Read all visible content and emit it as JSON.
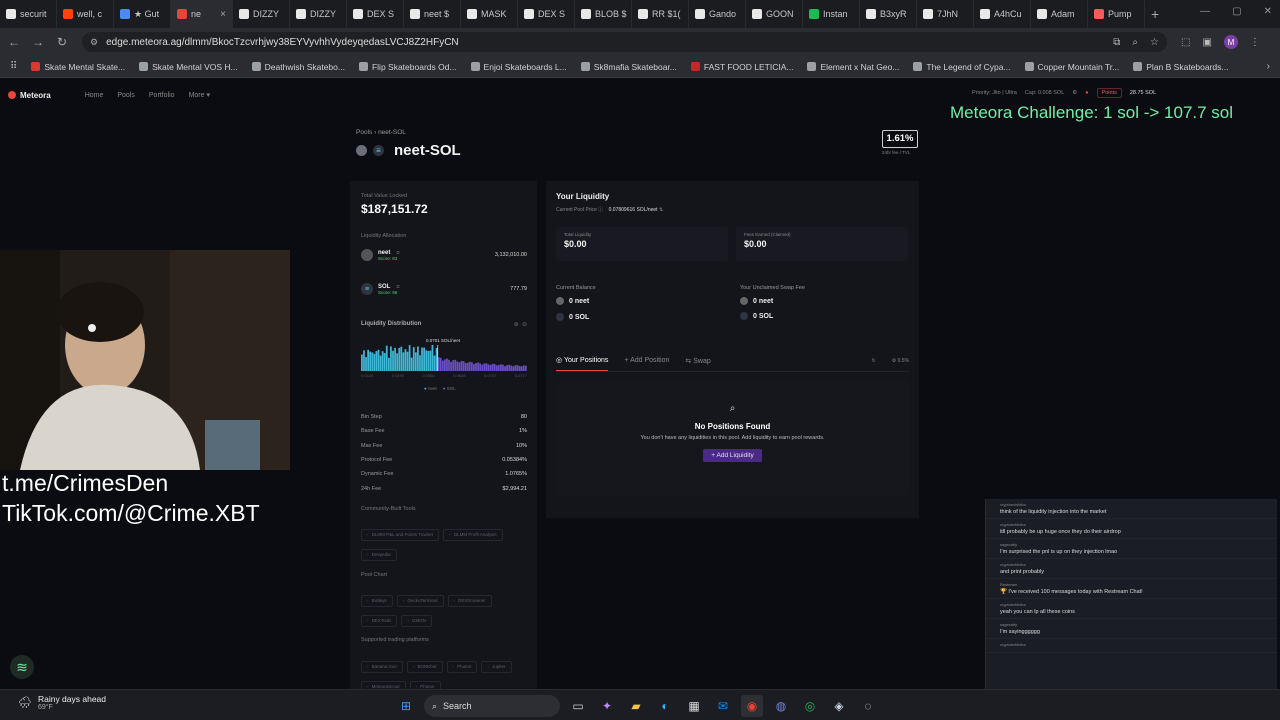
{
  "browser": {
    "tabs": [
      {
        "label": "securit",
        "icon": "doc-icon"
      },
      {
        "label": "well, c",
        "icon": "reddit-icon"
      },
      {
        "label": "★ Gut",
        "icon": "bookmark-icon"
      },
      {
        "label": "ne",
        "icon": "meteora-icon",
        "active": true
      },
      {
        "label": "DIZZY",
        "icon": "dex-icon"
      },
      {
        "label": "DIZZY",
        "icon": "dex-icon"
      },
      {
        "label": "DEX S",
        "icon": "dex-icon"
      },
      {
        "label": "neet $",
        "icon": "dex-icon"
      },
      {
        "label": "MASK",
        "icon": "dex-icon"
      },
      {
        "label": "DEX S",
        "icon": "dex-icon"
      },
      {
        "label": "BLOB $",
        "icon": "dex-icon"
      },
      {
        "label": "RR $1(",
        "icon": "dex-icon"
      },
      {
        "label": "Gando",
        "icon": "dex-icon"
      },
      {
        "label": "GOON",
        "icon": "dex-icon"
      },
      {
        "label": "Instan",
        "icon": "spotify-icon"
      },
      {
        "label": "B3xyR",
        "icon": "globe-icon"
      },
      {
        "label": "7JhN",
        "icon": "globe-icon"
      },
      {
        "label": "A4hCu",
        "icon": "globe-icon"
      },
      {
        "label": "Adam",
        "icon": "x-icon"
      },
      {
        "label": "Pump",
        "icon": "pump-icon"
      }
    ],
    "new_tab_glyph": "+",
    "url": "edge.meteora.ag/dlmm/BkocTzcvrhjwy38EYVyvhhVydeyqedasLVCJ8Z2HFyCN",
    "bookmarks": [
      "Skate Mental Skate...",
      "Skate Mental VOS H...",
      "Deathwish Skatebo...",
      "Flip Skateboards Od...",
      "Enjoi Skateboards L...",
      "Sk8mafia Skateboar...",
      "FAST FOOD LETICIA...",
      "Element x Nat Geo...",
      "The Legend of Cypa...",
      "Copper Mountain Tr...",
      "Plan B Skateboards..."
    ],
    "bookmark_colors": [
      "#d83b2b",
      "#9aa0a6",
      "#9aa0a6",
      "#9aa0a6",
      "#9aa0a6",
      "#9aa0a6",
      "#c62828",
      "#9aa0a6",
      "#9aa0a6",
      "#9aa0a6",
      "#9aa0a6"
    ],
    "profile_initial": "M"
  },
  "meteora": {
    "brand": "Meteora",
    "nav": [
      "Home",
      "Pools",
      "Portfolio",
      "More"
    ],
    "top_right": {
      "priority": "Priority: Jito | Ultra",
      "cap": "Cap: 0.008 SOL",
      "points": "Points",
      "balance": "28.75 SOL"
    }
  },
  "overlay": {
    "challenge": "Meteora Challenge: 1 sol -> 107.7 sol",
    "telegram": "t.me/CrimesDen",
    "tiktok": "TikTok.com/@Crime.XBT"
  },
  "pool": {
    "breadcrumb": [
      "Pools",
      "neet-SOL"
    ],
    "name": "neet-SOL",
    "apr": "1.61%",
    "apr_label": "24hr fee / TVL",
    "tvl_label": "Total Value Locked",
    "tvl": "$187,151.72",
    "alloc_label": "Liquidity Allocation",
    "tokens": [
      {
        "symbol": "neet",
        "score": "Score: 83",
        "amount": "3,132,010.00"
      },
      {
        "symbol": "SOL",
        "score": "Score: 96",
        "amount": "777.79"
      }
    ],
    "dist_label": "Liquidity Distribution",
    "dist_price": "0.0701 SOL/neet",
    "dist_axis": [
      "0.0420",
      "0.0490",
      "0.0560",
      "0.0638",
      "0.0707",
      "0.0777"
    ],
    "dist_legend": [
      "neet",
      "SOL"
    ],
    "params": [
      {
        "label": "Bin Step",
        "value": "80"
      },
      {
        "label": "Base Fee",
        "value": "1%"
      },
      {
        "label": "Max Fee",
        "value": "10%"
      },
      {
        "label": "Protocol Fee",
        "value": "0.05384%"
      },
      {
        "label": "Dynamic Fee",
        "value": "1.0765%"
      },
      {
        "label": "24h Fee",
        "value": "$2,994.21"
      }
    ],
    "community_label": "Community-Built Tools",
    "community_tools": [
      "DLMM P&L and Points Tracker",
      "DLMM Profit Analysis",
      "Dexpedia"
    ],
    "chart_label": "Pool Chart",
    "chart_links": [
      "Birdeye",
      "GeckoTerminal",
      "DEXScreener",
      "DEXTools",
      "GMGN"
    ],
    "platforms_label": "Supported trading platforms",
    "platforms": [
      "Banana Gun",
      "BONKbot",
      "Photon",
      "Jupiter",
      "MeteoraScout",
      "Photon"
    ]
  },
  "liquidity": {
    "title": "Your Liquidity",
    "price_label": "Current Pool Price",
    "price": "0.07809616 SOL/neet",
    "total_label": "Total Liquidity",
    "total": "$0.00",
    "fees_label": "Fees Earned (Claimed)",
    "fees": "$0.00",
    "balance_label": "Current Balance",
    "balance_neet": "0 neet",
    "balance_sol": "0 SOL",
    "unclaimed_label": "Your Unclaimed Swap Fee",
    "unclaimed_neet": "0 neet",
    "unclaimed_sol": "0 SOL",
    "tabs": [
      "Your Positions",
      "Add Position",
      "Swap"
    ],
    "slippage": "0.5%",
    "empty_title": "No Positions Found",
    "empty_text": "You don't have any liquidities in this pool. Add liquidity to earn pool rewards.",
    "add_button": "+ Add Liquidity"
  },
  "chat": [
    {
      "user": "cryptoexhibitor",
      "text": "think of the liquidity injection into the market"
    },
    {
      "user": "cryptoexhibitor",
      "text": "itll probably be up huge once they do their airdrop"
    },
    {
      "user": "sagecatty",
      "text": "I'm surprised the pnl is up on they injection lmao"
    },
    {
      "user": "cryptoexhibitor",
      "text": "and print probably"
    },
    {
      "user": "Restream",
      "text": "🏆 I've received 100 messages today with Restream Chat!"
    },
    {
      "user": "cryptoexhibitor",
      "text": "yeah you can lp all these coins"
    },
    {
      "user": "sagecatty",
      "text": "I'm sayingggggg"
    },
    {
      "user": "cryptoexhibitor",
      "text": ""
    }
  ],
  "taskbar": {
    "weather_title": "Rainy days ahead",
    "weather_temp": "69°F",
    "search": "Search"
  }
}
